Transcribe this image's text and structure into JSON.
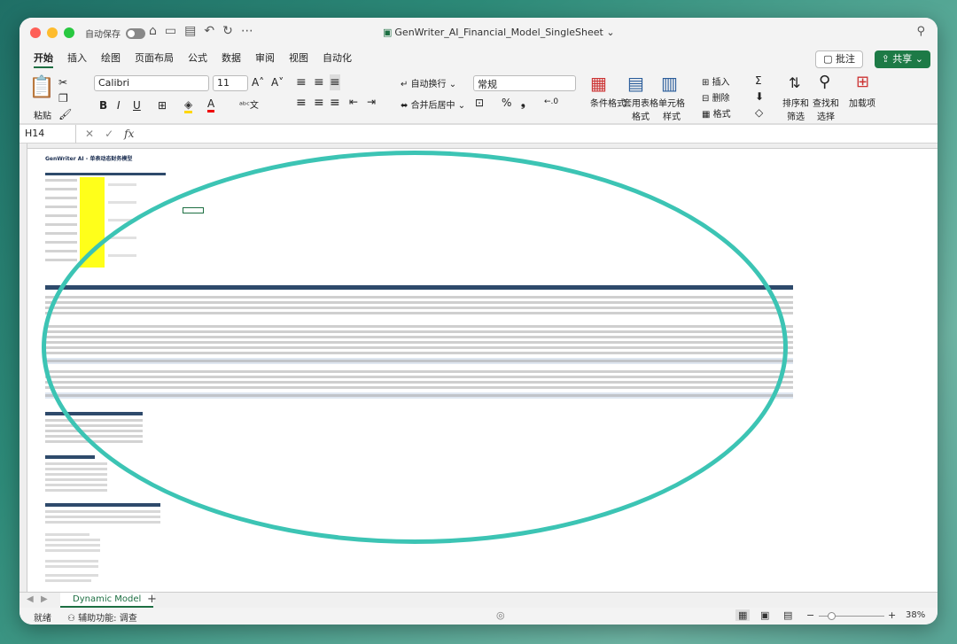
{
  "titlebar": {
    "autosave_label": "自动保存",
    "document_title": "GenWriter_AI_Financial_Model_SingleSheet"
  },
  "menu": {
    "tabs": [
      "开始",
      "插入",
      "绘图",
      "页面布局",
      "公式",
      "数据",
      "审阅",
      "视图",
      "自动化"
    ],
    "comment_label": "批注",
    "share_label": "共享"
  },
  "ribbon": {
    "paste_label": "粘贴",
    "font_name": "Calibri",
    "font_size": "11",
    "wrap_label": "自动换行",
    "merge_label": "合并后居中",
    "number_format": "常规",
    "cond_format_label": "条件格式",
    "table_format_label": "套用表格格式",
    "cell_style_label": "单元格样式",
    "insert_label": "插入",
    "delete_label": "删除",
    "format_label": "格式",
    "sort_label": "排序和筛选",
    "find_label": "查找和选择",
    "addins_label": "加载项"
  },
  "formula_bar": {
    "cell_ref": "H14",
    "fx_label": "fx",
    "formula": ""
  },
  "sheet": {
    "title": "GenWriter AI - 单表动态财务模型",
    "zoom_note": "content rendered at 38% zoom"
  },
  "sheet_tabs": {
    "active": "Dynamic Model",
    "add_label": "+"
  },
  "status_bar": {
    "ready": "就绪",
    "accessibility": "辅助功能: 调查",
    "zoom": "38%"
  },
  "colors": {
    "excel_green": "#1d6f42",
    "highlight_ellipse": "#3cc4b4",
    "input_yellow": "#ffff1a",
    "header_navy": "#2e4a6b"
  }
}
